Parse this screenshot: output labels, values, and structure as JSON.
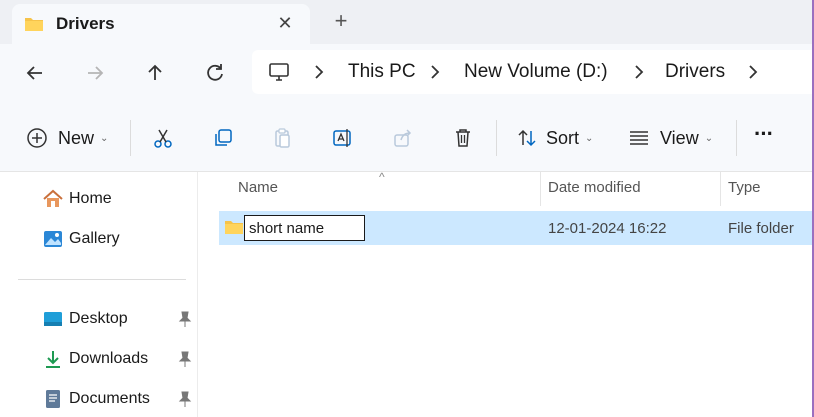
{
  "tab": {
    "title": "Drivers",
    "close_glyph": "✕",
    "new_tab_glyph": "+"
  },
  "address": {
    "crumbs": [
      "This PC",
      "New Volume (D:)",
      "Drivers"
    ]
  },
  "toolbar": {
    "new_label": "New",
    "sort_label": "Sort",
    "view_label": "View",
    "more_glyph": "···",
    "caret": "⌄"
  },
  "sidebar": {
    "items": [
      {
        "label": "Home",
        "icon": "home-icon"
      },
      {
        "label": "Gallery",
        "icon": "gallery-icon"
      },
      {
        "label": "Desktop",
        "icon": "desktop-icon"
      },
      {
        "label": "Downloads",
        "icon": "downloads-icon"
      },
      {
        "label": "Documents",
        "icon": "documents-icon"
      }
    ]
  },
  "filelist": {
    "columns": [
      "Name",
      "Date modified",
      "Type"
    ],
    "sort_glyph": "^",
    "rows": [
      {
        "name": "short name",
        "date": "12-01-2024 16:22",
        "type": "File folder"
      }
    ]
  },
  "colors": {
    "selection": "#cce8ff",
    "folder": "#f6c34a",
    "accent": "#0067c0"
  }
}
